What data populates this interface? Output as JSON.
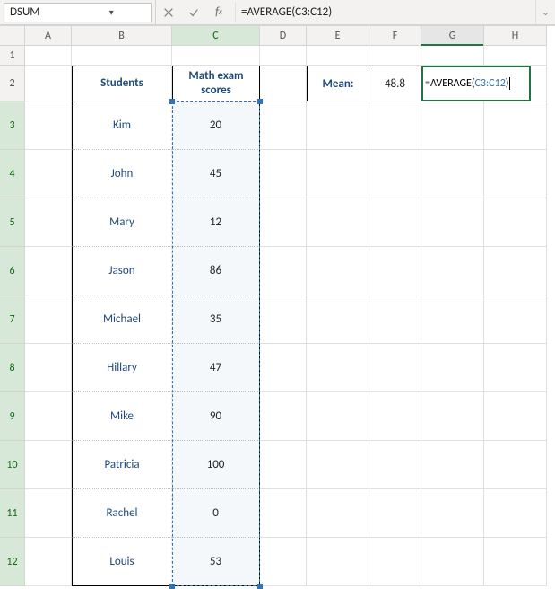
{
  "namebox": "DSUM",
  "formula_bar": "=AVERAGE(C3:C12)",
  "columns": [
    "A",
    "B",
    "C",
    "D",
    "E",
    "F",
    "G",
    "H"
  ],
  "rows": [
    "1",
    "2",
    "3",
    "4",
    "5",
    "6",
    "7",
    "8",
    "9",
    "10",
    "11",
    "12"
  ],
  "table": {
    "header_students": "Students",
    "header_scores": "Math exam scores",
    "rows": [
      {
        "name": "Kim",
        "score": "20"
      },
      {
        "name": "John",
        "score": "45"
      },
      {
        "name": "Mary",
        "score": "12"
      },
      {
        "name": "Jason",
        "score": "86"
      },
      {
        "name": "Michael",
        "score": "35"
      },
      {
        "name": "Hillary",
        "score": "47"
      },
      {
        "name": "Mike",
        "score": "90"
      },
      {
        "name": "Patricia",
        "score": "100"
      },
      {
        "name": "Rachel",
        "score": "0"
      },
      {
        "name": "Louis",
        "score": "53"
      }
    ]
  },
  "mean": {
    "label": "Mean:",
    "value": "48.8"
  },
  "editcell": {
    "prefix": "=AVERAGE(",
    "range": "C3:C12",
    "suffix": ")"
  },
  "chart_data": {
    "type": "table",
    "title": "Math exam scores",
    "categories": [
      "Kim",
      "John",
      "Mary",
      "Jason",
      "Michael",
      "Hillary",
      "Mike",
      "Patricia",
      "Rachel",
      "Louis"
    ],
    "values": [
      20,
      45,
      12,
      86,
      35,
      47,
      90,
      100,
      0,
      53
    ],
    "mean": 48.8
  }
}
